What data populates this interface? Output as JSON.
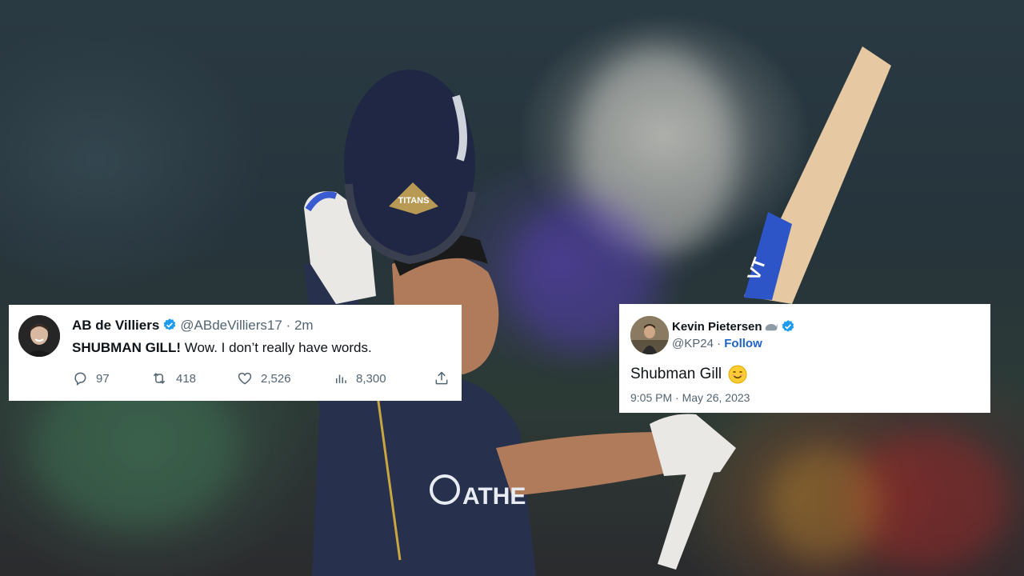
{
  "tweet_left": {
    "name": "AB de Villiers",
    "handle": "@ABdeVilliers17",
    "separator": "·",
    "time": "2m",
    "text_bold": "SHUBMAN GILL!",
    "text_rest": " Wow. I don’t really have words.",
    "reply_count": "97",
    "retweet_count": "418",
    "like_count": "2,526",
    "view_count": "8,300"
  },
  "tweet_right": {
    "name": "Kevin Pietersen",
    "handle": "@KP24",
    "separator": "·",
    "follow_label": "Follow",
    "text": "Shubman Gill",
    "time": "9:05 PM",
    "date": "May 26, 2023",
    "emoji": "smiling-face-emoji"
  },
  "photo": {
    "helmet_logo_text": "TITANS",
    "jersey_text": "ATHE",
    "bat_text": "VT"
  },
  "colors": {
    "verified_blue": "#1d9bf0",
    "follow_blue": "#1d64c4",
    "muted_text": "#536471",
    "helmet_navy": "#1f2744",
    "jersey_navy": "#2a3556"
  }
}
